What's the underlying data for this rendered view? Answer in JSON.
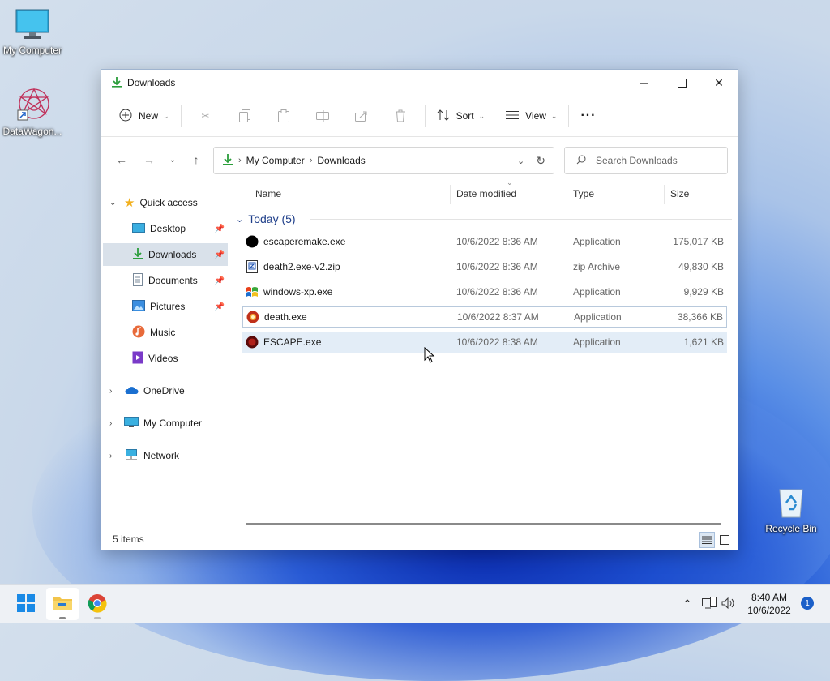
{
  "desktop": {
    "icons": [
      {
        "label": "My Computer",
        "icon": "monitor-icon"
      },
      {
        "label": "DataWagon...",
        "icon": "datawagon-shortcut-icon"
      },
      {
        "label": "Recycle Bin",
        "icon": "recycle-bin-icon"
      }
    ]
  },
  "window": {
    "title": "Downloads",
    "toolbar": {
      "new_label": "New",
      "sort_label": "Sort",
      "view_label": "View",
      "more_label": "···"
    },
    "address": {
      "crumbs": [
        "My Computer",
        "Downloads"
      ]
    },
    "search": {
      "placeholder": "Search Downloads"
    },
    "sidebar": {
      "quick_access": "Quick access",
      "items": [
        {
          "label": "Desktop",
          "icon": "desktop-folder-icon",
          "pinned": true
        },
        {
          "label": "Downloads",
          "icon": "downloads-folder-icon",
          "pinned": true,
          "selected": true
        },
        {
          "label": "Documents",
          "icon": "documents-folder-icon",
          "pinned": true
        },
        {
          "label": "Pictures",
          "icon": "pictures-folder-icon",
          "pinned": true
        },
        {
          "label": "Music",
          "icon": "music-folder-icon",
          "pinned": false
        },
        {
          "label": "Videos",
          "icon": "videos-folder-icon",
          "pinned": false
        }
      ],
      "roots": [
        {
          "label": "OneDrive",
          "icon": "onedrive-icon"
        },
        {
          "label": "My Computer",
          "icon": "computer-icon"
        },
        {
          "label": "Network",
          "icon": "network-icon"
        }
      ]
    },
    "columns": {
      "name": "Name",
      "date": "Date modified",
      "type": "Type",
      "size": "Size"
    },
    "group_label": "Today (5)",
    "files": [
      {
        "name": "escaperemake.exe",
        "date": "10/6/2022 8:36 AM",
        "type": "Application",
        "size": "175,017 KB",
        "icon": "black-circle-app-icon"
      },
      {
        "name": "death2.exe-v2.zip",
        "date": "10/6/2022 8:36 AM",
        "type": "zip Archive",
        "size": "49,830 KB",
        "icon": "zip-archive-icon"
      },
      {
        "name": "windows-xp.exe",
        "date": "10/6/2022 8:36 AM",
        "type": "Application",
        "size": "9,929 KB",
        "icon": "windows-xp-flag-icon"
      },
      {
        "name": "death.exe",
        "date": "10/6/2022 8:37 AM",
        "type": "Application",
        "size": "38,366 KB",
        "icon": "red-orb-app-icon"
      },
      {
        "name": "ESCAPE.exe",
        "date": "10/6/2022 8:38 AM",
        "type": "Application",
        "size": "1,621 KB",
        "icon": "dark-red-orb-app-icon"
      }
    ],
    "status": "5 items"
  },
  "taskbar": {
    "time": "8:40 AM",
    "date": "10/6/2022",
    "notification_count": "1"
  },
  "colors": {
    "accent": "#0067c0",
    "selection": "#e3edf7",
    "download_green": "#2a9d3a"
  }
}
